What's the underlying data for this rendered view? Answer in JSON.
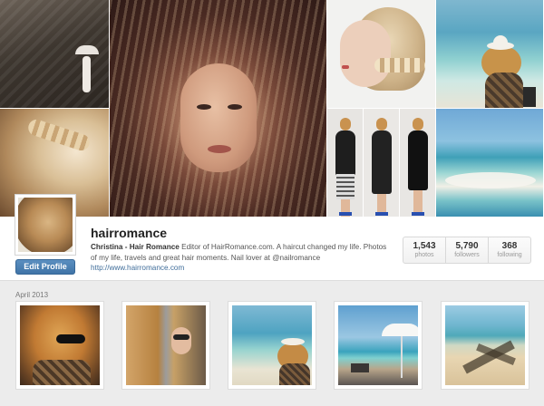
{
  "profile": {
    "username": "hairromance",
    "bio_name": "Christina - Hair Romance",
    "bio_text": " Editor of HairRomance.com. A haircut changed my life. Photos of my life, travels and great hair moments. Nail lover at @nailromance",
    "website": "http://www.hairromance.com",
    "edit_label": "Edit Profile"
  },
  "stats": [
    {
      "value": "1,543",
      "label": "photos"
    },
    {
      "value": "5,790",
      "label": "followers"
    },
    {
      "value": "368",
      "label": "following"
    }
  ],
  "feed": {
    "month_label": "April 2013"
  },
  "colors": {
    "button_blue": "#3f74a7",
    "link_blue": "#3f6d9a",
    "background": "#ececec"
  }
}
